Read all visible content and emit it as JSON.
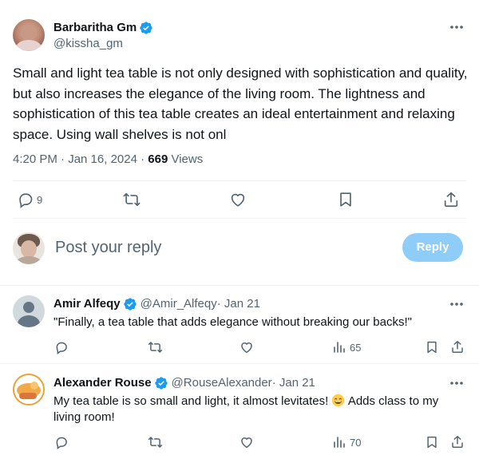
{
  "main_tweet": {
    "author_name": "Barbaritha Gm",
    "author_handle": "@kissha_gm",
    "text": "Small and light tea table is not only designed with sophistication and quality, but also increases the elegance of the living room. The lightness and sophistication of this tea table creates an ideal entertainment and relaxing space. Using wall shelves is not onl",
    "timestamp": "4:20 PM · Jan 16, 2024 · ",
    "views_count": "669",
    "views_label": " Views",
    "reply_count": "9"
  },
  "reply_box": {
    "placeholder": "Post your reply",
    "button_label": "Reply"
  },
  "replies": [
    {
      "author_name": "Amir Alfeqy",
      "author_handle": "@Amir_Alfeqy",
      "date": " · Jan 21",
      "text": "\"Finally, a tea table that adds elegance without breaking our backs!\"",
      "views": "65"
    },
    {
      "author_name": "Alexander Rouse",
      "author_handle": "@RouseAlexander",
      "date": " · Jan 21",
      "text_line1_before": "My tea table is so small and light, it almost levitates! ",
      "text_line1_after": " Adds class to my",
      "text_line2": "living room!",
      "views": "70"
    }
  ],
  "colors": {
    "accent": "#1d9bf0",
    "muted": "#536471",
    "reply_button": "#8ecdf8"
  }
}
